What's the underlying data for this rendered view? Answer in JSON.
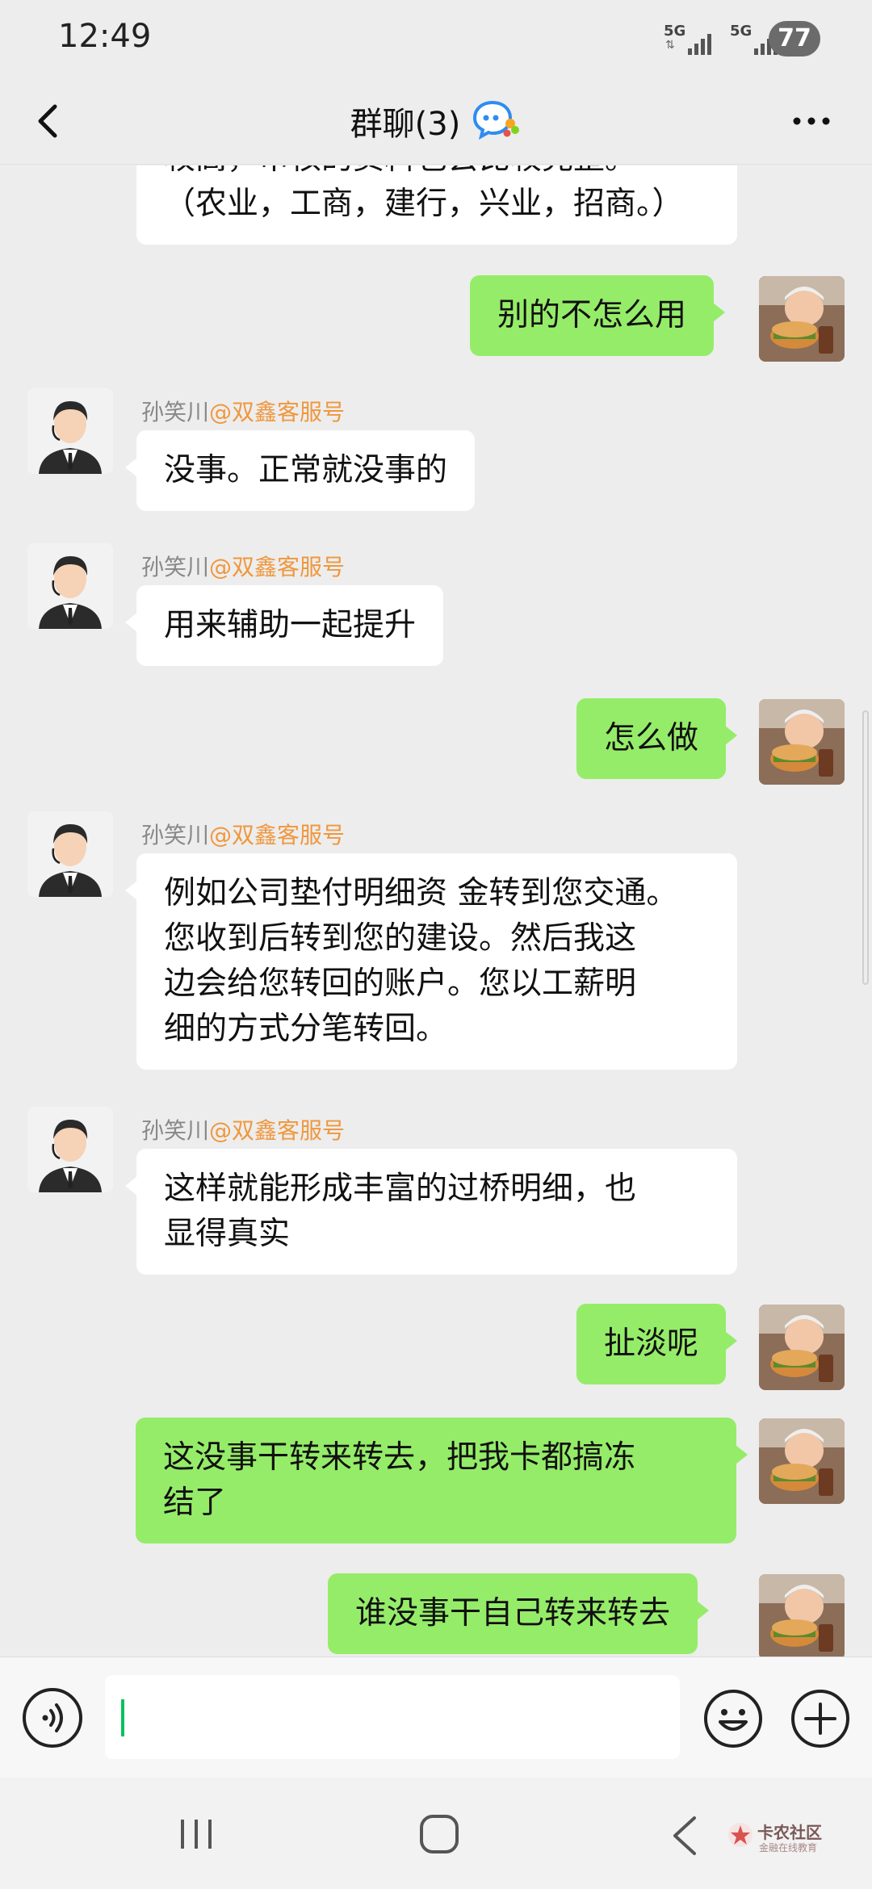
{
  "status_bar": {
    "time": "12:49",
    "sim1_label": "5G",
    "sim2_label": "5G",
    "battery": "77"
  },
  "header": {
    "title": "群聊(3)",
    "back_icon": "chevron-left-icon",
    "more_icon": "more-horizontal-icon",
    "group_icon": "group-chat-icon"
  },
  "messages": [
    {
      "side": "left",
      "sender": "",
      "tag": "",
      "lines": [
        "较高，审核的资料也会比较完整。",
        "（农业，工商，建行，兴业，招商。）"
      ]
    },
    {
      "side": "right",
      "text": "别的不怎么用"
    },
    {
      "side": "left",
      "sender": "孙笑川",
      "tag": "@双鑫客服号",
      "text": "没事。正常就没事的"
    },
    {
      "side": "left",
      "sender": "孙笑川",
      "tag": "@双鑫客服号",
      "text": "用来辅助一起提升"
    },
    {
      "side": "right",
      "text": "怎么做"
    },
    {
      "side": "left",
      "sender": "孙笑川",
      "tag": "@双鑫客服号",
      "lines": [
        "例如公司垫付明细资 金转到您交通。",
        "您收到后转到您的建设。然后我这",
        "边会给您转回的账户。您以工薪明",
        "细的方式分笔转回。"
      ]
    },
    {
      "side": "left",
      "sender": "孙笑川",
      "tag": "@双鑫客服号",
      "lines": [
        "这样就能形成丰富的过桥明细，也",
        "显得真实"
      ]
    },
    {
      "side": "right",
      "text": "扯淡呢"
    },
    {
      "side": "right",
      "lines": [
        "这没事干转来转去，把我卡都搞冻",
        "结了"
      ]
    },
    {
      "side": "right",
      "text": "谁没事干自己转来转去"
    }
  ],
  "input_bar": {
    "value": "",
    "voice_icon": "voice-icon",
    "emoji_icon": "emoji-icon",
    "plus_icon": "plus-circle-icon"
  },
  "nav_bar": {
    "recent_icon": "recent-apps-icon",
    "home_icon": "home-icon",
    "back_icon": "back-icon"
  },
  "watermark": {
    "title": "卡农社区",
    "subtitle": "金融在线教育"
  },
  "colors": {
    "background": "#ededed",
    "my_bubble": "#95ec69",
    "their_bubble": "#ffffff",
    "sender_tag": "#f0973d",
    "caret": "#07c160"
  }
}
